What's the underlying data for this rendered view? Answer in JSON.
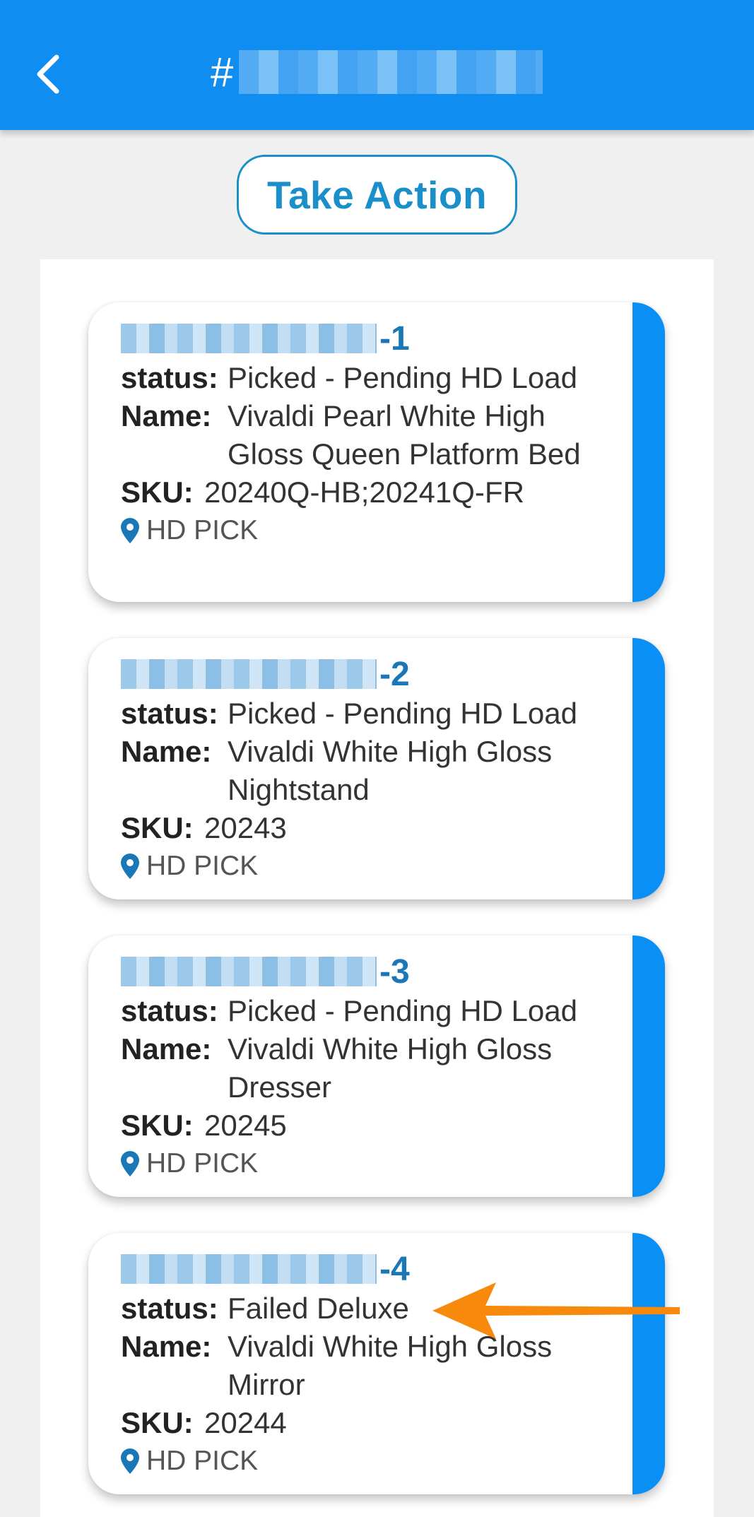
{
  "header": {
    "back_icon": "chevron-left-icon",
    "title_prefix": "#"
  },
  "action_button": "Take Action",
  "labels": {
    "status": "status:",
    "name": "Name:",
    "sku": "SKU:"
  },
  "items": [
    {
      "suffix": "-1",
      "status": "Picked - Pending HD Load",
      "name": "Vivaldi Pearl White High Gloss Queen Platform Bed",
      "sku": "20240Q-HB;20241Q-FR",
      "location": "HD PICK"
    },
    {
      "suffix": "-2",
      "status": "Picked - Pending HD Load",
      "name": "Vivaldi White High Gloss Nightstand",
      "sku": "20243",
      "location": "HD PICK"
    },
    {
      "suffix": "-3",
      "status": "Picked - Pending HD Load",
      "name": "Vivaldi White High Gloss Dresser",
      "sku": "20245",
      "location": "HD PICK"
    },
    {
      "suffix": "-4",
      "status": "Failed Deluxe",
      "name": "Vivaldi White High Gloss Mirror",
      "sku": "20244",
      "location": "HD PICK"
    }
  ],
  "colors": {
    "header": "#0f8df0",
    "accent": "#1a8fc9",
    "stripe": "#0a8ff5",
    "arrow": "#f7890c"
  }
}
